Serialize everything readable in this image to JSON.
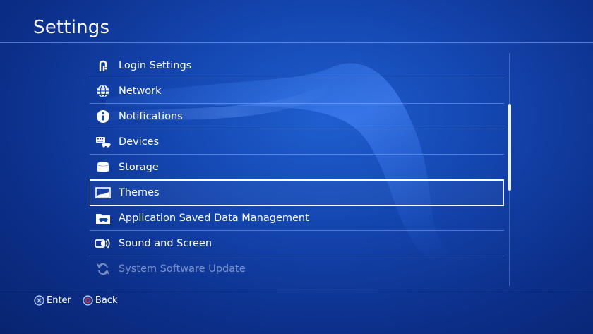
{
  "header": {
    "title": "Settings"
  },
  "menu": {
    "items": [
      {
        "label": "Login Settings",
        "icon": "login-settings-icon"
      },
      {
        "label": "Network",
        "icon": "globe-icon"
      },
      {
        "label": "Notifications",
        "icon": "info-icon"
      },
      {
        "label": "Devices",
        "icon": "devices-icon"
      },
      {
        "label": "Storage",
        "icon": "storage-icon"
      },
      {
        "label": "Themes",
        "icon": "themes-icon",
        "selected": true
      },
      {
        "label": "Application Saved Data Management",
        "icon": "folder-gamepad-icon"
      },
      {
        "label": "Sound and Screen",
        "icon": "sound-screen-icon"
      },
      {
        "label": "System Software Update",
        "icon": "refresh-icon"
      }
    ]
  },
  "footer": {
    "enter_label": "Enter",
    "back_label": "Back",
    "enter_icon": "cross-button-icon",
    "back_icon": "circle-button-icon"
  },
  "colors": {
    "background": "#1446b0",
    "text": "#ffffff",
    "divider": "#8cb4ff",
    "selection_outline": "#ffffff",
    "circle_button": "#e0303c"
  }
}
